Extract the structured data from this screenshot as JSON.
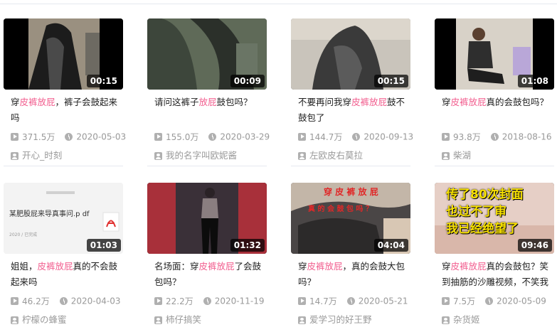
{
  "videos": [
    {
      "title_pre": "穿",
      "title_hl": "皮裤放屁",
      "title_post": "，裤子会鼓起来吗",
      "duration": "00:15",
      "views": "371.5万",
      "date": "2020-05-03",
      "author": "开心_时刻"
    },
    {
      "title_pre": "请问这裤子",
      "title_hl": "放屁",
      "title_post": "鼓包吗？",
      "duration": "00:09",
      "views": "155.0万",
      "date": "2020-03-29",
      "author": "我的名字叫欧妮酱"
    },
    {
      "title_pre": "不要再问我穿",
      "title_hl": "皮裤放屁",
      "title_post": "鼓不鼓包了",
      "duration": "00:15",
      "views": "144.7万",
      "date": "2020-09-13",
      "author": "左欧皮右莫拉"
    },
    {
      "title_pre": "穿",
      "title_hl": "皮裤放屁",
      "title_post": "真的会鼓包吗？",
      "duration": "01:08",
      "views": "93.8万",
      "date": "2018-08-16",
      "author": "柴湖"
    },
    {
      "title_pre": "姐姐，",
      "title_hl": "皮裤放屁",
      "title_post": "真的不会鼓起来吗",
      "duration": "01:03",
      "views": "46.2万",
      "date": "2020-04-03",
      "author": "柠檬の蜂蜜",
      "thumb_text": "某肥股屁来导真事问.p df",
      "thumb_small": "2020 / 已完成"
    },
    {
      "title_pre": "名场面：穿",
      "title_hl": "皮裤放屁",
      "title_post": "了会鼓包吗？",
      "duration": "01:32",
      "views": "22.2万",
      "date": "2020-11-19",
      "author": "柿仔搞笑"
    },
    {
      "title_pre": "穿",
      "title_hl": "皮裤放屁",
      "title_post": "，真的会鼓大包吗？",
      "duration": "04:04",
      "views": "14.7万",
      "date": "2020-05-21",
      "author": "爱学习的好王野",
      "thumb_line1": "穿 皮 裤 放 屁",
      "thumb_line2": "真 的 会 鼓 包 吗 ？"
    },
    {
      "title_pre": "穿",
      "title_hl": "皮裤放屁",
      "title_post": "真的会鼓包？笑到抽筋的沙雕视频，不笑我",
      "duration": "09:46",
      "views": "7.5万",
      "date": "2020-05-09",
      "author": "杂货姬",
      "thumb_line1": "传了80次封面",
      "thumb_line2": "也过不了审",
      "thumb_line3": "我已经绝望了"
    }
  ],
  "colors": {
    "highlight": "#f25d8e",
    "meta": "#999999"
  }
}
